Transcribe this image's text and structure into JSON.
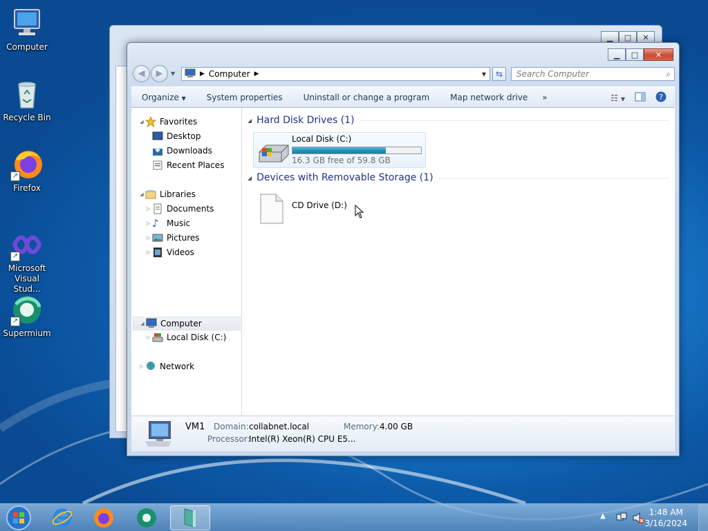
{
  "desktop_icons": [
    {
      "label": "Computer"
    },
    {
      "label": "Recycle Bin"
    },
    {
      "label": "Firefox"
    },
    {
      "label": "Microsoft Visual Stud..."
    },
    {
      "label": "Supermium"
    }
  ],
  "explorer": {
    "address": {
      "location": "Computer"
    },
    "search_placeholder": "Search Computer",
    "toolbar": {
      "organize": "Organize",
      "system_properties": "System properties",
      "uninstall": "Uninstall or change a program",
      "map_drive": "Map network drive",
      "more": "»"
    },
    "nav": {
      "favorites": "Favorites",
      "desktop": "Desktop",
      "downloads": "Downloads",
      "recent": "Recent Places",
      "libraries": "Libraries",
      "documents": "Documents",
      "music": "Music",
      "pictures": "Pictures",
      "videos": "Videos",
      "computer": "Computer",
      "local_disk": "Local Disk (C:)",
      "network": "Network"
    },
    "groups": {
      "hdd": "Hard Disk Drives (1)",
      "removable": "Devices with Removable Storage (1)"
    },
    "drive_c": {
      "name": "Local Disk (C:)",
      "free": "16.3 GB free of 59.8 GB",
      "used_fraction": 0.727
    },
    "drive_d": {
      "name": "CD Drive (D:)"
    },
    "status": {
      "name": "VM1",
      "domain_label": "Domain:",
      "domain": "collabnet.local",
      "memory_label": "Memory:",
      "memory": "4.00 GB",
      "processor_label": "Processor:",
      "processor": "Intel(R) Xeon(R) CPU E5..."
    }
  },
  "taskbar": {
    "time": "1:48 AM",
    "date": "3/16/2024"
  },
  "colors": {
    "accent": "#1e3287",
    "bar": "#2692b4"
  }
}
